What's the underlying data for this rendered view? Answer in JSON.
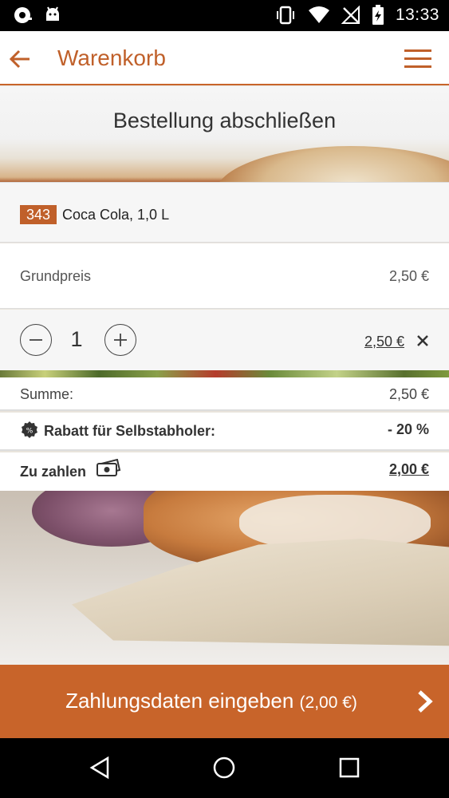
{
  "status_bar": {
    "time": "13:33",
    "left_icons": [
      "notification-icon",
      "android-debug-icon"
    ],
    "right_icons": [
      "vibrate-icon",
      "wifi-icon",
      "no-signal-icon",
      "battery-charging-icon"
    ]
  },
  "app_bar": {
    "title": "Warenkorb",
    "back_icon": "arrow-left-icon",
    "menu_icon": "menu-icon"
  },
  "hero": {
    "heading": "Bestellung abschließen"
  },
  "cart_item": {
    "number": "343",
    "name": "Coca Cola, 1,0 L",
    "base_price_label": "Grundpreis",
    "base_price": "2,50 €",
    "quantity": "1",
    "line_total": "2,50 €"
  },
  "summary": {
    "sum_label": "Summe:",
    "sum_value": "2,50 €",
    "discount_label": "Rabatt für Selbstabholer:",
    "discount_value": "- 20 %",
    "pay_label": "Zu zahlen",
    "pay_value": "2,00 €"
  },
  "cta": {
    "label": "Zahlungsdaten eingeben",
    "amount": "(2,00 €)"
  },
  "colors": {
    "accent": "#c8642a",
    "title": "#c0602a"
  }
}
